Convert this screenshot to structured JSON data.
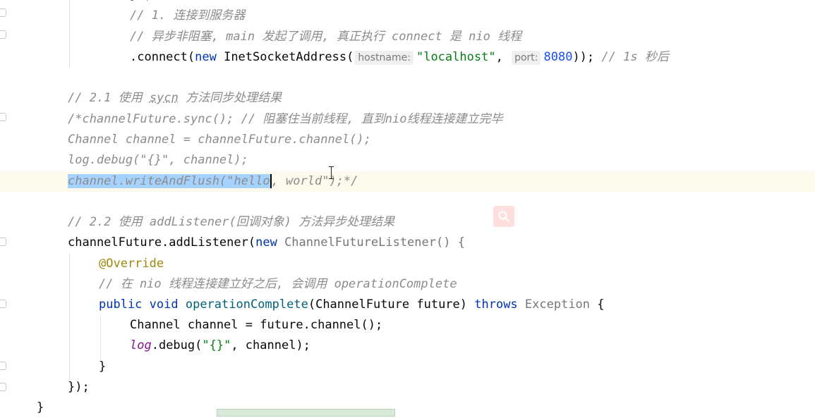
{
  "code": {
    "line_top_partial": "});",
    "comment_connect": "// 1. 连接到服务器",
    "comment_async": "// 异步非阻塞, main 发起了调用, 真正执行 connect 是 nio 线程",
    "connect_prefix": ".connect(",
    "kw_new": "new",
    "inet_call": " InetSocketAddress(",
    "hint_hostname": "hostname:",
    "str_localhost": "\"localhost\"",
    "comma": ",",
    "hint_port": "port:",
    "num_port": "8080",
    "connect_suffix": "));",
    "comment_1s": "// 1s 秒后",
    "comment_21_a": "// 2.1 使用 ",
    "comment_21_sycn": "sycn",
    "comment_21_b": " 方法同步处理结果",
    "block_line1": "/*channelFuture.sync(); // 阻塞住当前线程, 直到nio线程连接建立完毕",
    "block_line2": "Channel channel = channelFuture.channel();",
    "block_line3": "log.debug(\"{}\", channel);",
    "block_line4_selected": "channel.writeAndFlush(\"hello",
    "block_line4_rest": ", world\");*/",
    "comment_22": "// 2.2 使用 addListener(回调对象) 方法异步处理结果",
    "listener_a": "channelFuture.addListener(",
    "listener_new": "new",
    "listener_b": " ChannelFutureListener() {",
    "annotation": "@Override",
    "comment_nio": "// 在 nio 线程连接建立好之后, 会调用 operationComplete",
    "kw_public": "public",
    "kw_void": " void ",
    "fn_opcomplete": "operationComplete",
    "op_params": "(ChannelFuture future) ",
    "kw_throws": "throws",
    "exception": " Exception",
    "op_brace": " {",
    "inner_line1": "Channel channel = future.channel();",
    "inner_log": "log",
    "inner_debug_a": ".debug(",
    "inner_str": "\"{}\"",
    "inner_debug_b": ", channel);",
    "close_brace_inner": "}",
    "close_listener": "});",
    "close_class": "}"
  },
  "colors": {
    "keyword": "#0033b3",
    "string": "#067d17",
    "number": "#1750eb",
    "comment": "#8c8c8c",
    "annotation": "#9e880d",
    "selection": "#a6d2ff"
  },
  "icons": {
    "search": "search-icon",
    "cursor": "text-cursor-icon"
  }
}
